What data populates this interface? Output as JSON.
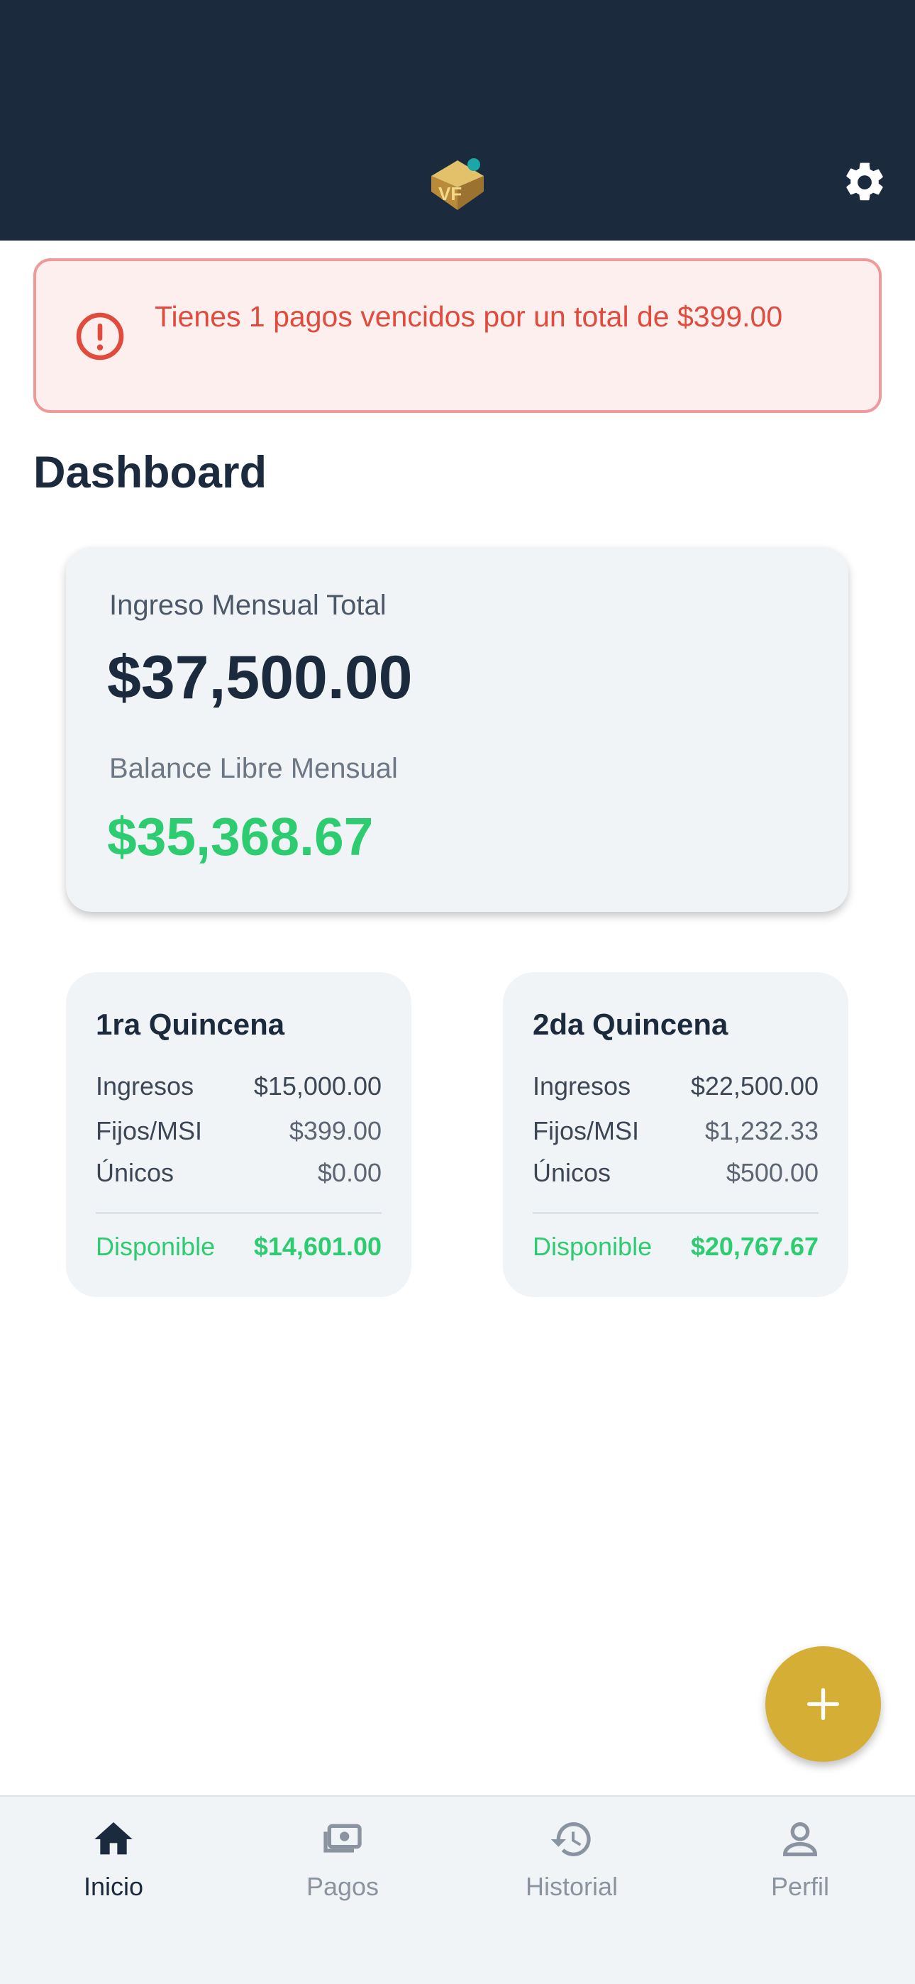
{
  "alert": {
    "text": "Tienes 1 pagos vencidos por un total de $399.00"
  },
  "page_title": "Dashboard",
  "summary": {
    "income_label": "Ingreso Mensual Total",
    "income_value": "$37,500.00",
    "balance_label": "Balance Libre Mensual",
    "balance_value": "$35,368.67"
  },
  "quincenas": [
    {
      "title": "1ra Quincena",
      "rows": [
        {
          "label": "Ingresos",
          "value": "$15,000.00"
        },
        {
          "label": "Fijos/MSI",
          "value": "$399.00"
        },
        {
          "label": "Únicos",
          "value": "$0.00"
        }
      ],
      "available_label": "Disponible",
      "available_value": "$14,601.00"
    },
    {
      "title": "2da Quincena",
      "rows": [
        {
          "label": "Ingresos",
          "value": "$22,500.00"
        },
        {
          "label": "Fijos/MSI",
          "value": "$1,232.33"
        },
        {
          "label": "Únicos",
          "value": "$500.00"
        }
      ],
      "available_label": "Disponible",
      "available_value": "$20,767.67"
    }
  ],
  "nav": [
    {
      "label": "Inicio",
      "icon": "home-icon",
      "active": true
    },
    {
      "label": "Pagos",
      "icon": "money-icon",
      "active": false
    },
    {
      "label": "Historial",
      "icon": "history-icon",
      "active": false
    },
    {
      "label": "Perfil",
      "icon": "person-icon",
      "active": false
    }
  ],
  "colors": {
    "header": "#1c2a3d",
    "alert_text": "#e04b3e",
    "positive": "#2ecc71",
    "fab": "#d4ae35"
  }
}
